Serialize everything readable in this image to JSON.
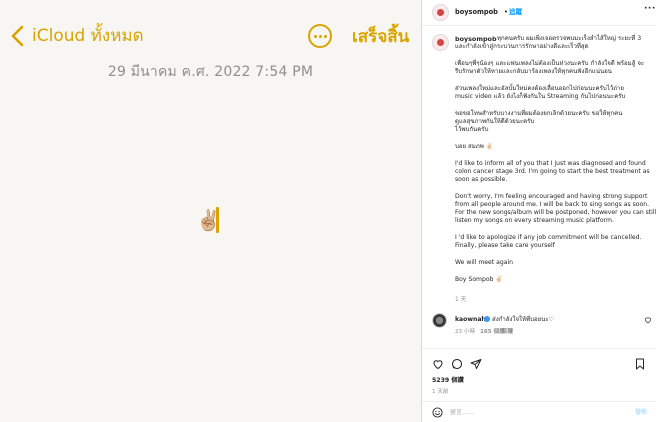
{
  "notes": {
    "back_label": "iCloud ทั้งหมด",
    "done_label": "เสร็จสิ้น",
    "date": "29 มีนาคม ค.ศ. 2022 7:54 PM",
    "body": "✌🏼"
  },
  "post": {
    "header": {
      "username": "boysompob",
      "dot": "•",
      "follow_label": "追蹤",
      "more": "···"
    },
    "caption": {
      "username": "boysompob",
      "lines": [
        "ทุกคนครับ ผมเพิ่งเจอตรวจพบมะเร็งลำไส้ใหญ่ ระยะที่ 3",
        "และกำลังเข้าสู่กระบวนการรักษาอย่างดีและเร็วที่สุด",
        "เพื่อนๆพี่ๆน้องๆ และแฟนเพลงไม่ต้องเป็นห่วงนะครับ กำลังใจดี พร้อมสู้ จะ",
        "รีบรักษาตัวให้หายและกลับมาร้องเพลงให้ทุกคนฟังอีกแน่นอน",
        "ส่วนเพลงใหม่และอัลบั้มใหม่คงต้องเลื่อนออกไปก่อนนะครับไว้ถ่าย",
        "music video แล้ว ยังไงก็ฟังกันใน Streaming กันไปก่อนนะครับ",
        "ขอขอโทษสำหรับบางงานที่ผมต้องยกเลิกด้วยนะครับ ขอให้ทุกคน",
        "ดูแลสุขภาพกันให้ดีด้วยนะครับ",
        "ไว้พบกันครับ",
        "บอย สมภพ ✌🏻",
        "I'd like to inform all of you that I just was diagnosed and found",
        "colon cancer stage 3rd. I'm going to start the best treatment as",
        "soon as possible.",
        "Don't worry, I'm feeling encouraged and having strong support",
        "from all people around me. I will be back to sing songs as soon.",
        "For the new songs/album will be postponed, however you can still",
        "listen my songs on every streaming music platform.",
        "I 'd like to apologize if any job commitment will be cancelled.",
        "Finally, please take care yourself",
        "We will meet again",
        "Boy Sompob ✌🏻"
      ],
      "time": "1 天"
    },
    "comment": {
      "username": "kaownah",
      "text": "ส่งกำลังใจให้พี่บอยนะ♡",
      "time": "23 小時",
      "likes": "165 個讚",
      "reply": "回覆"
    },
    "likes_count": "5239 個讚",
    "age": "1 天前",
    "comment_placeholder": "留言……",
    "post_label": "發佈"
  }
}
